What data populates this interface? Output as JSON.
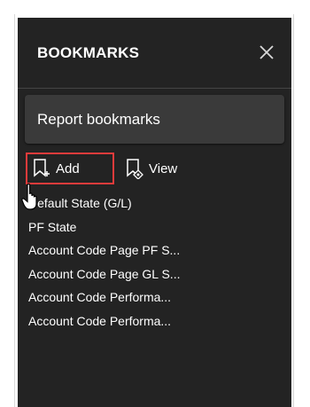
{
  "panel": {
    "title": "BOOKMARKS",
    "close_icon": "close-icon",
    "report_bookmarks_label": "Report bookmarks"
  },
  "toolbar": {
    "add_label": "Add",
    "add_icon": "bookmark-add-icon",
    "view_label": "View",
    "view_icon": "bookmark-view-icon",
    "highlight_color": "#e23b3b"
  },
  "bookmarks": [
    "Default State (G/L)",
    "PF State",
    "Account Code Page PF S...",
    "Account Code Page GL S...",
    "Account Code Performa...",
    "Account Code Performa..."
  ],
  "colors": {
    "panel_bg": "#232323",
    "button_bg": "#3a3a3a",
    "text": "#ffffff"
  }
}
